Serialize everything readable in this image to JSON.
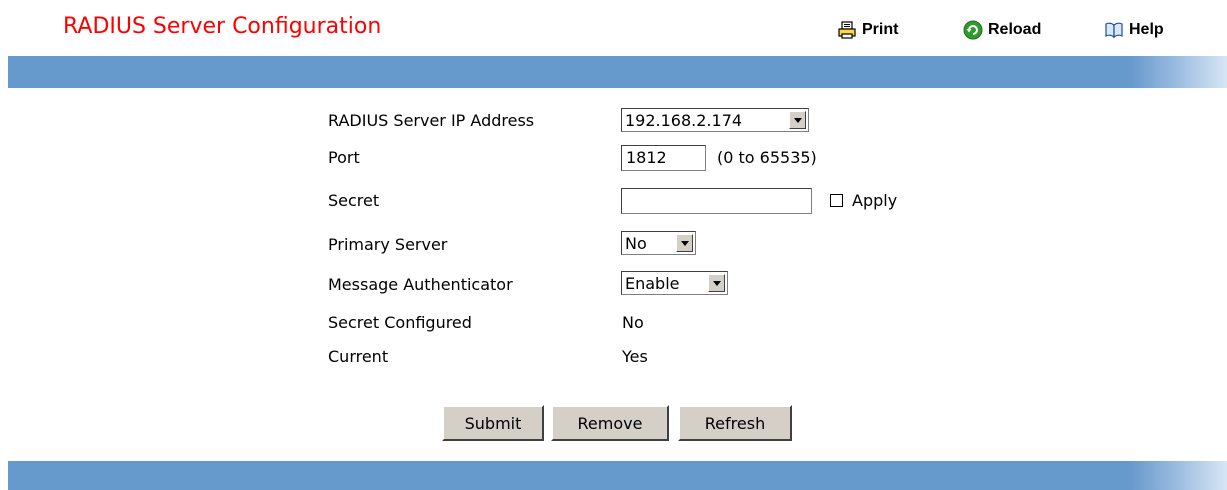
{
  "header": {
    "title": "RADIUS Server Configuration",
    "title_color": "#ff0000",
    "print_label": "Print",
    "reload_label": "Reload",
    "help_label": "Help"
  },
  "form": {
    "server_ip": {
      "label": "RADIUS Server IP Address",
      "value": "192.168.2.174"
    },
    "port": {
      "label": "Port",
      "value": "1812",
      "hint": "(0 to 65535)"
    },
    "secret": {
      "label": "Secret",
      "value": "",
      "apply_label": "Apply",
      "apply_checked": false
    },
    "primary_server": {
      "label": "Primary Server",
      "value": "No"
    },
    "message_authenticator": {
      "label": "Message Authenticator",
      "value": "Enable"
    },
    "secret_configured": {
      "label": "Secret Configured",
      "value": "No"
    },
    "current": {
      "label": "Current",
      "value": "Yes"
    }
  },
  "buttons": {
    "submit": "Submit",
    "remove": "Remove",
    "refresh": "Refresh"
  },
  "colors": {
    "bar": "#6699cc",
    "button_face": "#d4d0c8"
  },
  "icons": {
    "print": "printer-icon",
    "reload": "reload-icon",
    "help": "book-icon"
  }
}
